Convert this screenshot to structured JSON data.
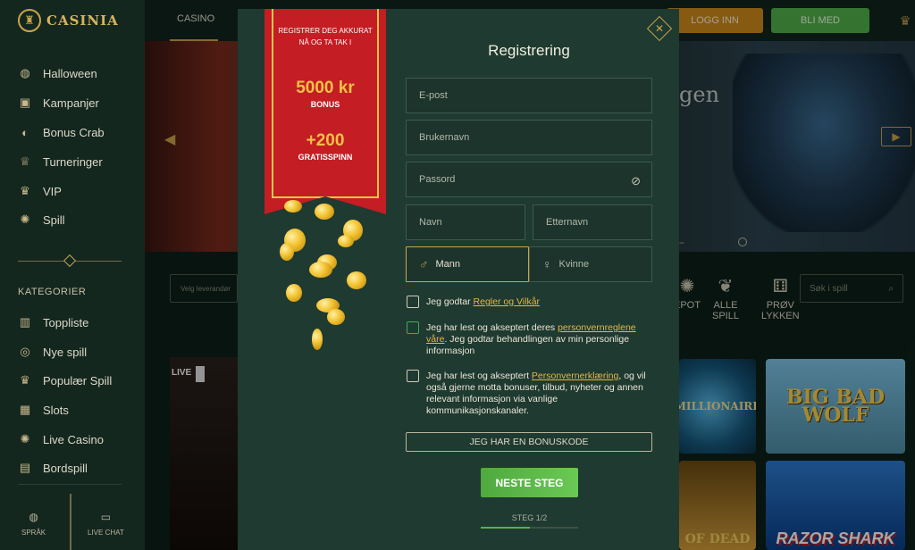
{
  "brand": {
    "name": "CASINIA"
  },
  "sidebar": {
    "items": [
      {
        "label": "Halloween",
        "icon": "pumpkin-icon"
      },
      {
        "label": "Kampanjer",
        "icon": "gift-icon"
      },
      {
        "label": "Bonus Crab",
        "icon": "crab-icon"
      },
      {
        "label": "Turneringer",
        "icon": "trophy-icon"
      },
      {
        "label": "VIP",
        "icon": "crown-icon"
      },
      {
        "label": "Spill",
        "icon": "chip-icon"
      }
    ],
    "category_title": "KATEGORIER",
    "categories": [
      {
        "label": "Toppliste",
        "icon": "podium-icon"
      },
      {
        "label": "Nye spill",
        "icon": "target-icon"
      },
      {
        "label": "Populær Spill",
        "icon": "crown-icon"
      },
      {
        "label": "Slots",
        "icon": "grid-icon"
      },
      {
        "label": "Live Casino",
        "icon": "chip-icon"
      },
      {
        "label": "Bordspill",
        "icon": "cards-icon"
      }
    ],
    "bottom": {
      "language": "SPRÅK",
      "chat": "LIVE CHAT"
    }
  },
  "topbar": {
    "tab": "CASINO",
    "login": "LOGG INN",
    "join": "BLI MED"
  },
  "hero": {
    "text": "gen"
  },
  "filters": {
    "provider_placeholder": "Velg leverandør",
    "search_placeholder": "Søk i spill",
    "categories": [
      {
        "label": "JACKPOT",
        "short": "EPOT"
      },
      {
        "label": "ALLE SPILL",
        "line1": "ALLE",
        "line2": "SPILL"
      },
      {
        "label": "PRØV LYKKEN",
        "line1": "PRØV",
        "line2": "LYKKEN"
      }
    ]
  },
  "games": {
    "live_badge": "LIVE",
    "tiles": [
      "MILLIONAIRE",
      "BIG BAD WOLF",
      "OF DEAD",
      "RAZOR SHARK"
    ]
  },
  "promo": {
    "top_text": "REGISTRER DEG AKKURAT NÅ OG TA TAK I",
    "amount": "5000 kr",
    "amount_label": "BONUS",
    "spins": "+200",
    "spins_label": "GRATISSPINN"
  },
  "form": {
    "title": "Registrering",
    "email_placeholder": "E-post",
    "username_placeholder": "Brukernavn",
    "password_placeholder": "Passord",
    "firstname_placeholder": "Navn",
    "lastname_placeholder": "Etternavn",
    "male": "Mann",
    "female": "Kvinne",
    "terms_prefix": "Jeg godtar ",
    "terms_link": "Regler og Vilkår",
    "privacy_prefix": "Jeg har lest og akseptert deres ",
    "privacy_link": "personvernreglene våre",
    "privacy_suffix": ". Jeg godtar behandlingen av min personlige informasjon",
    "marketing_prefix": "Jeg har lest og akseptert ",
    "marketing_link": "Personvernerklæring",
    "marketing_suffix": ", og vil også gjerne motta bonuser, tilbud, nyheter og annen relevant informasjon via vanlige kommunikasjonskanaler.",
    "bonus_code": "JEG HAR EN BONUSKODE",
    "next": "NESTE STEG",
    "step": "STEG 1/2"
  },
  "colors": {
    "gold": "#c9a44a",
    "green": "#52b34a",
    "orange": "#d08a1c",
    "ribbon": "#c41d23"
  }
}
